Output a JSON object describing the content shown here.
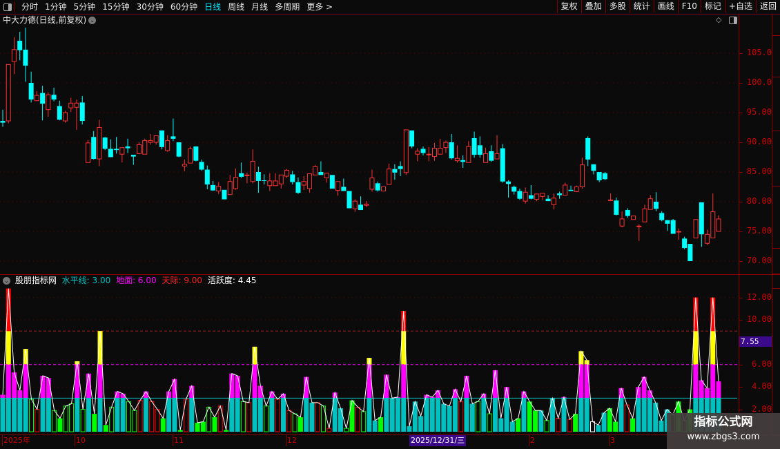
{
  "topbar": {
    "tabs": [
      "分时",
      "1分钟",
      "5分钟",
      "15分钟",
      "30分钟",
      "60分钟",
      "日线",
      "周线",
      "月线",
      "多周期",
      "更多 >"
    ],
    "active_tab": "日线",
    "buttons": [
      "复权",
      "叠加",
      "多股",
      "统计",
      "画线",
      "F10",
      "标记",
      "+自选",
      "返回"
    ]
  },
  "main": {
    "title": "中大力德(日线,前复权)",
    "price_axis": [
      "105.0",
      "100.0",
      "95.00",
      "90.00",
      "85.00",
      "80.00",
      "75.00",
      "70.00"
    ]
  },
  "indicator": {
    "name": "股朋指标网",
    "level_label": "水平线: 3.00",
    "ground_label": "地面: 6.00",
    "sky_label": "天际: 9.00",
    "activity_label": "活跃度: 4.45",
    "axis": [
      "12.00",
      "10.00",
      "6.00",
      "4.00",
      "2.00"
    ],
    "cursor_value": "7.55",
    "colors": {
      "level": "#00c0c0",
      "ground": "#ff00ff",
      "sky": "#ff0000",
      "yellow": "#ffff00",
      "green": "#00ff00"
    }
  },
  "dates": {
    "labels": [
      "2025年",
      "10",
      "11",
      "12",
      "2",
      "3"
    ],
    "cursor_date": "2025/12/31/三"
  },
  "watermark": {
    "line1": "指标公式网",
    "line2": "www.zbgs3.com"
  },
  "colors": {
    "up": "#ff3232",
    "down": "#00ffff",
    "background": "#0b0b0b",
    "grid": "#8b0000"
  },
  "chart_data": [
    {
      "type": "candlestick",
      "ylim": [
        68.5,
        110
      ],
      "y_ticks": [
        70,
        75,
        80,
        85,
        90,
        95,
        100,
        105
      ],
      "ohlc": [
        [
          93.6,
          95.5,
          92.6,
          93.3
        ],
        [
          93.6,
          103.1,
          93.2,
          103.1
        ],
        [
          103.6,
          107.7,
          101.5,
          105.6
        ],
        [
          107.1,
          108.6,
          103.8,
          105.5
        ],
        [
          105.6,
          109.3,
          100.2,
          102.9
        ],
        [
          100,
          101.9,
          96.7,
          97.2
        ],
        [
          97.0,
          98.6,
          97.0,
          97.9
        ],
        [
          98.3,
          99.5,
          93.7,
          96.5
        ],
        [
          95.5,
          98.4,
          94.3,
          98.0
        ],
        [
          98,
          99.2,
          96.9,
          97.2
        ],
        [
          96.1,
          97,
          93.7,
          93.8
        ],
        [
          93.6,
          95.3,
          93.3,
          95.0
        ],
        [
          95.8,
          97.5,
          95.1,
          96.6
        ],
        [
          95.9,
          97.2,
          92.1,
          96.6
        ],
        [
          96.7,
          97.8,
          93.0,
          93.6
        ],
        [
          86.6,
          90.4,
          86.6,
          89.9
        ],
        [
          90.9,
          91.9,
          87.1,
          87.2
        ],
        [
          87.2,
          93.8,
          86.0,
          92.5
        ],
        [
          90.8,
          90.9,
          88.7,
          88.9
        ],
        [
          88.9,
          90.5,
          87.5,
          87.5
        ],
        [
          88.9,
          90.9,
          88.1,
          88.7
        ],
        [
          88.0,
          89.1,
          86.6,
          89.1
        ],
        [
          89.3,
          90.6,
          88.2,
          89.0
        ],
        [
          87.9,
          87.9,
          86.2,
          87.6
        ],
        [
          88.1,
          90.0,
          88.0,
          89.6
        ],
        [
          88.0,
          90.6,
          88.0,
          90.3
        ],
        [
          90.0,
          91.4,
          89.6,
          90.3
        ],
        [
          90.0,
          91.1,
          89.6,
          91.1
        ],
        [
          92.0,
          92.0,
          88.8,
          89.2
        ],
        [
          88.6,
          91.2,
          88.4,
          90.3
        ],
        [
          91.0,
          94.0,
          90.2,
          90.6
        ],
        [
          90.0,
          90.0,
          87.5,
          87.6
        ],
        [
          86.0,
          87.1,
          85.1,
          86.3
        ],
        [
          86.5,
          89.3,
          86.5,
          88.9
        ],
        [
          89.3,
          89.3,
          86.8,
          86.9
        ],
        [
          86.7,
          87.1,
          85.2,
          85.4
        ],
        [
          85.4,
          86.1,
          82.1,
          82.9
        ],
        [
          82.8,
          83.5,
          81.8,
          81.9
        ],
        [
          81.8,
          83.3,
          81.3,
          82.6
        ],
        [
          82.0,
          82.0,
          80.4,
          80.4
        ],
        [
          81.2,
          84.5,
          81.2,
          83.4
        ],
        [
          82.2,
          85.6,
          82.0,
          84.1
        ],
        [
          84.8,
          86.6,
          84.0,
          84.2
        ],
        [
          84.4,
          84.9,
          83.1,
          84.5
        ],
        [
          83.4,
          88.8,
          83.1,
          86.8
        ],
        [
          85.0,
          85.9,
          81.5,
          83.5
        ],
        [
          83.6,
          84.6,
          82.9,
          83.5
        ],
        [
          82.7,
          84.8,
          81.8,
          83.5
        ],
        [
          82.7,
          84.8,
          82.7,
          83.5
        ],
        [
          83.0,
          84.5,
          82.2,
          84.5
        ],
        [
          84.3,
          85.5,
          84.0,
          85.3
        ],
        [
          84.6,
          85.2,
          82.9,
          83.3
        ],
        [
          83.3,
          84.1,
          81.3,
          81.5
        ],
        [
          82.8,
          84.3,
          82.0,
          83.4
        ],
        [
          82.2,
          84.7,
          81.5,
          84.7
        ],
        [
          84.5,
          86.2,
          84.5,
          85.9
        ],
        [
          85.0,
          86.8,
          84.5,
          84.5
        ],
        [
          84.0,
          84.8,
          83.2,
          84.8
        ],
        [
          84.5,
          84.5,
          82.2,
          82.2
        ],
        [
          81.9,
          83.4,
          81.0,
          83.4
        ],
        [
          82.5,
          83.9,
          81.8,
          81.8
        ],
        [
          81.8,
          81.8,
          78.9,
          78.9
        ],
        [
          78.8,
          80.4,
          78.3,
          80.1
        ],
        [
          79.5,
          80.9,
          78.6,
          78.6
        ],
        [
          79.4,
          80.1,
          79.1,
          79.6
        ],
        [
          82.1,
          85.4,
          81.7,
          84.0
        ],
        [
          83.1,
          83.4,
          81.7,
          81.9
        ],
        [
          81.8,
          82.5,
          81.8,
          82.5
        ],
        [
          82.9,
          86.4,
          82.9,
          85.5
        ],
        [
          85.5,
          86.3,
          83.7,
          84.9
        ],
        [
          86.0,
          86.8,
          84.3,
          85.5
        ],
        [
          84.9,
          92.1,
          84.5,
          92.1
        ],
        [
          92.0,
          92.0,
          89.0,
          89.3
        ],
        [
          88.0,
          89.0,
          86.8,
          88.5
        ],
        [
          88.9,
          89.3,
          87.8,
          88.2
        ],
        [
          87.9,
          89.2,
          86.8,
          88.0
        ],
        [
          87.6,
          89.9,
          86.9,
          89.0
        ],
        [
          88.0,
          90.6,
          88.0,
          89.0
        ],
        [
          89.1,
          90.3,
          88.2,
          90.0
        ],
        [
          90.0,
          91.4,
          87.1,
          87.3
        ],
        [
          86.9,
          89.5,
          86.6,
          87.3
        ],
        [
          87.0,
          87.8,
          85.7,
          86.7
        ],
        [
          86.6,
          90.2,
          86.6,
          89.3
        ],
        [
          90.7,
          91.8,
          87.4,
          87.9
        ],
        [
          89.5,
          91.0,
          87.4,
          87.9
        ],
        [
          86.6,
          89.1,
          86.6,
          88.1
        ],
        [
          88.5,
          89.5,
          86.7,
          86.9
        ],
        [
          87.2,
          91.2,
          87.2,
          88.1
        ],
        [
          89.0,
          89.7,
          83.2,
          83.4
        ],
        [
          83.4,
          83.6,
          80.7,
          83.0
        ],
        [
          82.5,
          82.7,
          81.2,
          81.7
        ],
        [
          81.8,
          82.2,
          80.3,
          80.5
        ],
        [
          80.1,
          82.4,
          79.7,
          81.6
        ],
        [
          81.1,
          82.8,
          80.4,
          80.5
        ],
        [
          80.4,
          81.3,
          80.1,
          81.3
        ],
        [
          80.9,
          81.4,
          80.3,
          81.4
        ],
        [
          80.5,
          81.1,
          80.1,
          80.1
        ],
        [
          79.5,
          81.4,
          78.7,
          80.6
        ],
        [
          81.4,
          81.7,
          80.5,
          81.1
        ],
        [
          81.1,
          83.2,
          81.1,
          82.8
        ],
        [
          82.0,
          82.7,
          81.8,
          81.8
        ],
        [
          81.7,
          82.7,
          81.6,
          82.5
        ],
        [
          82.5,
          87.4,
          82.2,
          86.2
        ],
        [
          90.7,
          91.0,
          86.0,
          87.1
        ],
        [
          86.3,
          86.3,
          84.6,
          85.2
        ],
        [
          85.0,
          85.0,
          83.3,
          83.6
        ],
        [
          84.8,
          85.0,
          83.6,
          83.8
        ],
        [
          80.2,
          81.4,
          80.2,
          80.3
        ],
        [
          80.2,
          80.7,
          77.7,
          77.8
        ],
        [
          75.9,
          78.4,
          75.7,
          77.1
        ],
        [
          78.6,
          78.9,
          77.3,
          77.6
        ],
        [
          77.0,
          77.6,
          77.0,
          77.6
        ],
        [
          75.9,
          76.2,
          73.4,
          75.9
        ],
        [
          76.6,
          79.5,
          76.6,
          78.8
        ],
        [
          78.7,
          81.1,
          78.7,
          80.5
        ],
        [
          80.0,
          81.6,
          78.4,
          78.8
        ],
        [
          78.1,
          78.4,
          76.7,
          76.9
        ],
        [
          76.9,
          76.9,
          75.1,
          76.3
        ],
        [
          76.9,
          77.1,
          74.6,
          74.6
        ],
        [
          75.0,
          75.5,
          73.6,
          75.0
        ],
        [
          73.8,
          74.1,
          72.0,
          72.2
        ],
        [
          72.9,
          72.9,
          70.0,
          70.0
        ],
        [
          73.9,
          77.0,
          73.9,
          77.0
        ],
        [
          79.9,
          79.9,
          72.4,
          74.5
        ],
        [
          73.0,
          75.3,
          72.7,
          74.5
        ],
        [
          73.9,
          81.4,
          73.9,
          78.3
        ],
        [
          75.0,
          77.7,
          75.0,
          77.1
        ]
      ]
    },
    {
      "type": "bar",
      "ylim": [
        0,
        13.5
      ],
      "y_ticks": [
        2,
        4,
        6,
        10,
        12
      ],
      "reference_lines": [
        3,
        6,
        9
      ],
      "values": [
        3.3,
        12.8,
        5.3,
        3.7,
        7.4,
        2.9,
        2.0,
        5.0,
        4.8,
        1.9,
        1.2,
        2.3,
        2.5,
        6.3,
        2.0,
        5.2,
        1.6,
        9.0,
        0.6,
        2.2,
        3.6,
        3.4,
        2.7,
        1.9,
        2.8,
        3.6,
        2.7,
        2.0,
        1.2,
        3.6,
        4.7,
        0.15,
        2.9,
        4.1,
        0.8,
        0.9,
        2.2,
        1.3,
        2.3,
        0.15,
        5.2,
        5.0,
        2.7,
        2.6,
        7.6,
        4.1,
        2.3,
        3.6,
        2.9,
        3.4,
        1.9,
        1.6,
        1.3,
        4.9,
        2.6,
        2.6,
        2.3,
        0.3,
        3.5,
        2.1,
        0.3,
        2.8,
        2.2,
        1.8,
        6.6,
        1.0,
        1.3,
        5.1,
        3.0,
        3.1,
        10.8,
        0.5,
        2.7,
        1.4,
        3.3,
        3.1,
        3.7,
        2.5,
        2.3,
        3.8,
        2.7,
        5.0,
        2.5,
        2.7,
        3.4,
        1.6,
        5.5,
        1.2,
        4.0,
        0.9,
        1.2,
        3.6,
        2.7,
        1.9,
        1.9,
        1.0,
        3.0,
        1.2,
        3.1,
        1.1,
        1.6,
        7.2,
        6.4,
        0.9,
        0.6,
        1.7,
        2.1,
        0.9,
        3.9,
        2.4,
        1.2,
        4.0,
        4.9,
        3.7,
        2.6,
        1.0,
        2.0,
        1.5,
        2.7,
        1.0,
        2.0,
        12.0,
        4.6,
        3.9,
        12.0,
        4.5
      ],
      "bar_styles": "ccccchrcchfhhchcfcfhcchhrcrrfccfrcffhfrfcchrcchcrcrhfccrhrfchfrhrcfwchcc cfrfcccrhchchhchcfcffchrrfrfcfwccffhrfchwccchfhfhfhccccc"
    }
  ]
}
